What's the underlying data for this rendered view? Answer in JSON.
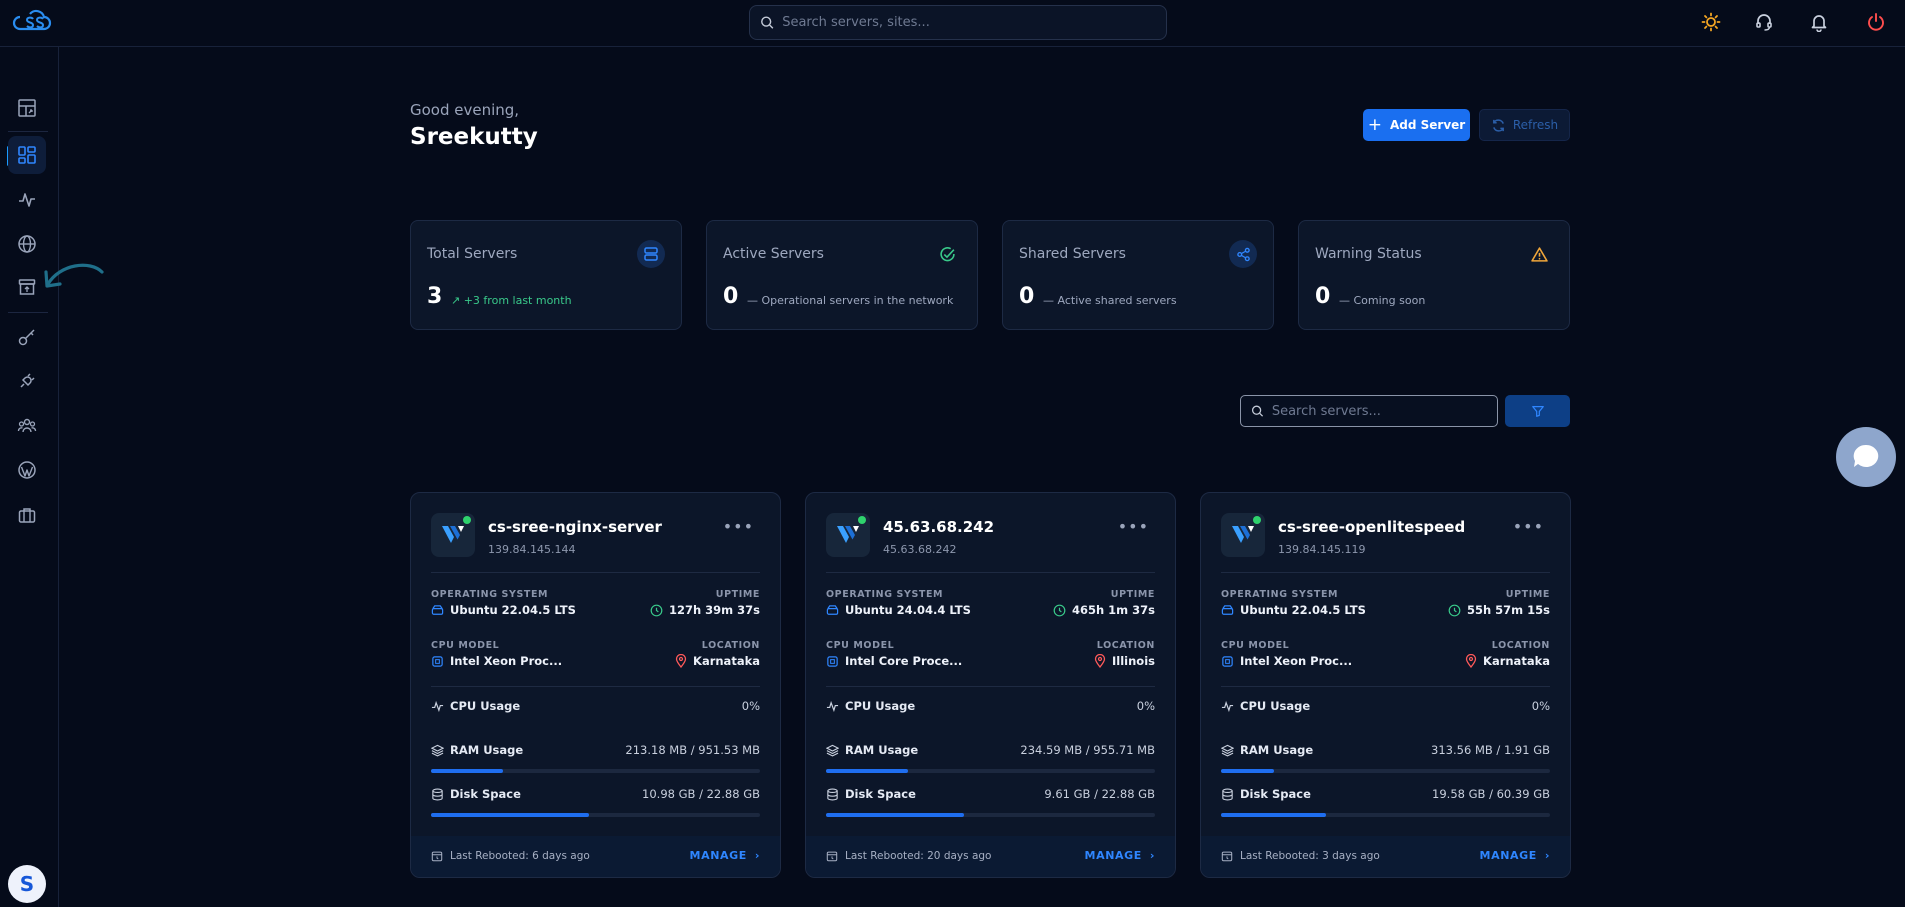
{
  "search": {
    "placeholder": "Search servers, sites..."
  },
  "greeting": {
    "text": "Good evening,",
    "name": "Sreekutty"
  },
  "actions": {
    "add_server": "Add Server",
    "refresh": "Refresh"
  },
  "stats": [
    {
      "title": "Total Servers",
      "value": "3",
      "sub": "+3 from last month",
      "icon": "server-icon"
    },
    {
      "title": "Active Servers",
      "value": "0",
      "sub": "Operational servers in the network",
      "icon": "check-circle-icon"
    },
    {
      "title": "Shared Servers",
      "value": "0",
      "sub": "Active shared servers",
      "icon": "share-icon"
    },
    {
      "title": "Warning Status",
      "value": "0",
      "sub": "Coming soon",
      "icon": "warning-icon"
    }
  ],
  "list_search": {
    "placeholder": "Search servers..."
  },
  "labels": {
    "os": "OPERATING SYSTEM",
    "uptime": "UPTIME",
    "cpu_model": "CPU MODEL",
    "location": "LOCATION",
    "cpu_usage": "CPU Usage",
    "ram_usage": "RAM Usage",
    "disk_space": "Disk Space",
    "manage": "MANAGE"
  },
  "servers": [
    {
      "name": "cs-sree-nginx-server",
      "ip": "139.84.145.144",
      "os": "Ubuntu 22.04.5 LTS",
      "uptime": "127h 39m 37s",
      "cpu_model": "Intel Xeon Proc...",
      "location": "Karnataka",
      "cpu": "0%",
      "ram": "213.18 MB / 951.53 MB",
      "ram_pct": 22,
      "disk": "10.98 GB / 22.88 GB",
      "disk_pct": 48,
      "rebooted": "Last Rebooted: 6 days ago"
    },
    {
      "name": "45.63.68.242",
      "ip": "45.63.68.242",
      "os": "Ubuntu 24.04.4 LTS",
      "uptime": "465h 1m 37s",
      "cpu_model": "Intel Core Proce...",
      "location": "Illinois",
      "cpu": "0%",
      "ram": "234.59 MB / 955.71 MB",
      "ram_pct": 25,
      "disk": "9.61 GB / 22.88 GB",
      "disk_pct": 42,
      "rebooted": "Last Rebooted: 20 days ago"
    },
    {
      "name": "cs-sree-openlitespeed",
      "ip": "139.84.145.119",
      "os": "Ubuntu 22.04.5 LTS",
      "uptime": "55h 57m 15s",
      "cpu_model": "Intel Xeon Proc...",
      "location": "Karnataka",
      "cpu": "0%",
      "ram": "313.56 MB / 1.91 GB",
      "ram_pct": 16,
      "disk": "19.58 GB / 60.39 GB",
      "disk_pct": 32,
      "rebooted": "Last Rebooted: 3 days ago"
    }
  ],
  "user": {
    "initial": "S"
  },
  "colors": {
    "accent": "#1a6ff0",
    "success": "#39c98a",
    "warning": "#f0a63a",
    "danger": "#ff4d4d"
  }
}
